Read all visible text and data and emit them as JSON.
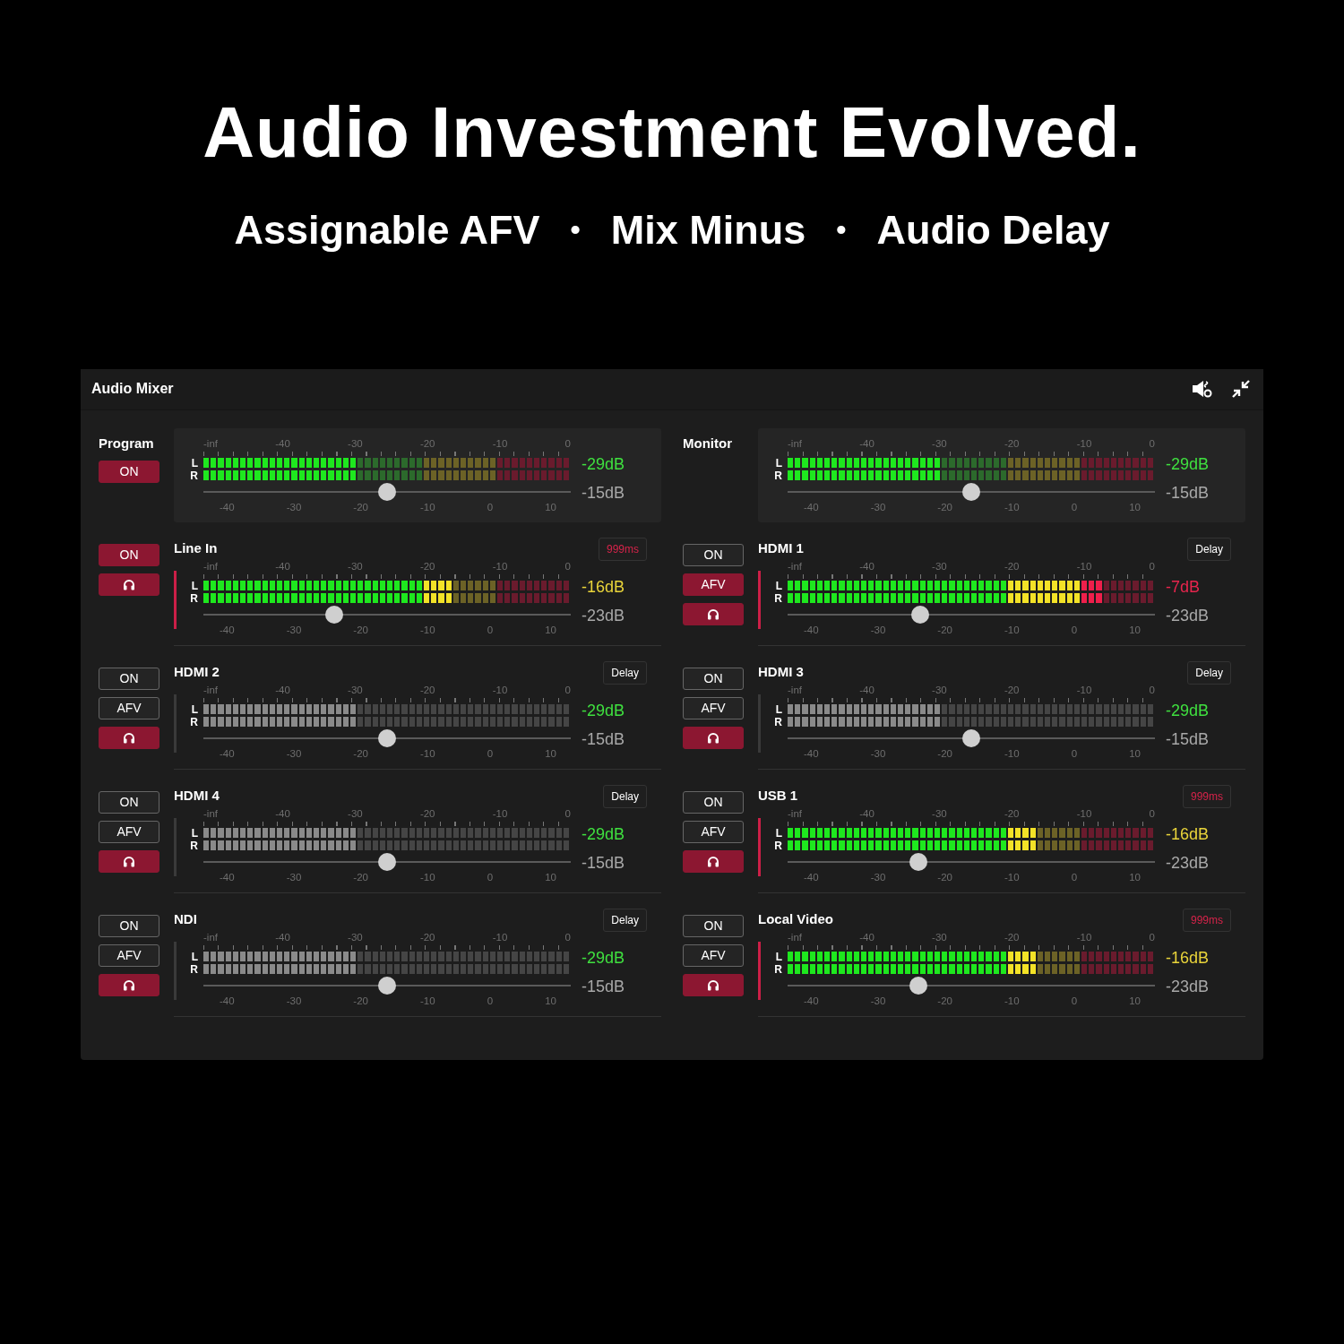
{
  "heading": "Audio Investment Evolved.",
  "subtitle": [
    {
      "kind": "feature",
      "text": "Assignable AFV"
    },
    {
      "kind": "separator",
      "text": "•"
    },
    {
      "kind": "feature",
      "text": "Mix Minus"
    },
    {
      "kind": "separator",
      "text": "•"
    },
    {
      "kind": "feature",
      "text": "Audio Delay"
    }
  ],
  "mixer": {
    "title": "Audio Mixer",
    "channels": [
      {
        "kind": "master",
        "name": "Program",
        "buttons": [
          {
            "kind": "on",
            "label": "ON",
            "selected": true
          }
        ],
        "signal": true,
        "meter_scale": [
          "-inf",
          "-40",
          "-30",
          "-20",
          "-10",
          "0"
        ],
        "channel_labels": [
          "L",
          "R"
        ],
        "meter": {
          "level": 0.42
        },
        "fader_scale": [
          "-40",
          "-30",
          "-20",
          "-10",
          "0",
          "10"
        ],
        "fader": {
          "level": 0.5
        },
        "peak": "-29dB",
        "gain": "-15dB"
      },
      {
        "kind": "master",
        "name": "Monitor",
        "signal": true,
        "meter_scale": [
          "-inf",
          "-40",
          "-30",
          "-20",
          "-10",
          "0"
        ],
        "channel_labels": [
          "L",
          "R"
        ],
        "meter": {
          "level": 0.42
        },
        "fader_scale": [
          "-40",
          "-30",
          "-20",
          "-10",
          "0",
          "10"
        ],
        "fader": {
          "level": 0.5
        },
        "peak": "-29dB",
        "gain": "-15dB"
      },
      {
        "kind": "input",
        "name": "Line In",
        "buttons": [
          {
            "kind": "on",
            "label": "ON",
            "selected": true
          },
          {
            "kind": "headphones",
            "selected": true
          }
        ],
        "delay": {
          "text": "999ms",
          "active": true
        },
        "signal": true,
        "meter_scale": [
          "-inf",
          "-40",
          "-30",
          "-20",
          "-10",
          "0"
        ],
        "channel_labels": [
          "L",
          "R"
        ],
        "meter": {
          "level": 0.68
        },
        "fader_scale": [
          "-40",
          "-30",
          "-20",
          "-10",
          "0",
          "10"
        ],
        "fader": {
          "level": 0.355
        },
        "peak": "-16dB",
        "gain": "-23dB"
      },
      {
        "kind": "input",
        "name": "HDMI 1",
        "buttons": [
          {
            "kind": "on",
            "label": "ON",
            "selected": false
          },
          {
            "kind": "afv",
            "label": "AFV",
            "selected": true
          },
          {
            "kind": "headphones",
            "selected": true
          }
        ],
        "delay": {
          "text": "Delay",
          "active": false
        },
        "signal": true,
        "meter_scale": [
          "-inf",
          "-40",
          "-30",
          "-20",
          "-10",
          "0"
        ],
        "channel_labels": [
          "L",
          "R"
        ],
        "meter": {
          "level": 0.86
        },
        "fader_scale": [
          "-40",
          "-30",
          "-20",
          "-10",
          "0",
          "10"
        ],
        "fader": {
          "level": 0.36
        },
        "peak": "-7dB",
        "gain": "-23dB"
      },
      {
        "kind": "input",
        "name": "HDMI 2",
        "buttons": [
          {
            "kind": "on",
            "label": "ON",
            "selected": false
          },
          {
            "kind": "afv",
            "label": "AFV",
            "selected": false
          },
          {
            "kind": "headphones",
            "selected": true
          }
        ],
        "delay": {
          "text": "Delay",
          "active": false
        },
        "signal": false,
        "meter_scale": [
          "-inf",
          "-40",
          "-30",
          "-20",
          "-10",
          "0"
        ],
        "channel_labels": [
          "L",
          "R"
        ],
        "meter": {
          "level": 0.42
        },
        "fader_scale": [
          "-40",
          "-30",
          "-20",
          "-10",
          "0",
          "10"
        ],
        "fader": {
          "level": 0.5
        },
        "peak": "-29dB",
        "gain": "-15dB"
      },
      {
        "kind": "input",
        "name": "HDMI 3",
        "buttons": [
          {
            "kind": "on",
            "label": "ON",
            "selected": false
          },
          {
            "kind": "afv",
            "label": "AFV",
            "selected": false
          },
          {
            "kind": "headphones",
            "selected": true
          }
        ],
        "delay": {
          "text": "Delay",
          "active": false
        },
        "signal": false,
        "meter_scale": [
          "-inf",
          "-40",
          "-30",
          "-20",
          "-10",
          "0"
        ],
        "channel_labels": [
          "L",
          "R"
        ],
        "meter": {
          "level": 0.42
        },
        "fader_scale": [
          "-40",
          "-30",
          "-20",
          "-10",
          "0",
          "10"
        ],
        "fader": {
          "level": 0.5
        },
        "peak": "-29dB",
        "gain": "-15dB"
      },
      {
        "kind": "input",
        "name": "HDMI 4",
        "buttons": [
          {
            "kind": "on",
            "label": "ON",
            "selected": false
          },
          {
            "kind": "afv",
            "label": "AFV",
            "selected": false
          },
          {
            "kind": "headphones",
            "selected": true
          }
        ],
        "delay": {
          "text": "Delay",
          "active": false
        },
        "signal": false,
        "meter_scale": [
          "-inf",
          "-40",
          "-30",
          "-20",
          "-10",
          "0"
        ],
        "channel_labels": [
          "L",
          "R"
        ],
        "meter": {
          "level": 0.42
        },
        "fader_scale": [
          "-40",
          "-30",
          "-20",
          "-10",
          "0",
          "10"
        ],
        "fader": {
          "level": 0.5
        },
        "peak": "-29dB",
        "gain": "-15dB"
      },
      {
        "kind": "input",
        "name": "USB 1",
        "buttons": [
          {
            "kind": "on",
            "label": "ON",
            "selected": false
          },
          {
            "kind": "afv",
            "label": "AFV",
            "selected": false
          },
          {
            "kind": "headphones",
            "selected": true
          }
        ],
        "delay": {
          "text": "999ms",
          "active": true
        },
        "signal": true,
        "meter_scale": [
          "-inf",
          "-40",
          "-30",
          "-20",
          "-10",
          "0"
        ],
        "channel_labels": [
          "L",
          "R"
        ],
        "meter": {
          "level": 0.68
        },
        "fader_scale": [
          "-40",
          "-30",
          "-20",
          "-10",
          "0",
          "10"
        ],
        "fader": {
          "level": 0.355
        },
        "peak": "-16dB",
        "gain": "-23dB"
      },
      {
        "kind": "input",
        "name": "NDI",
        "buttons": [
          {
            "kind": "on",
            "label": "ON",
            "selected": false
          },
          {
            "kind": "afv",
            "label": "AFV",
            "selected": false
          },
          {
            "kind": "headphones",
            "selected": true
          }
        ],
        "delay": {
          "text": "Delay",
          "active": false
        },
        "signal": false,
        "meter_scale": [
          "-inf",
          "-40",
          "-30",
          "-20",
          "-10",
          "0"
        ],
        "channel_labels": [
          "L",
          "R"
        ],
        "meter": {
          "level": 0.42
        },
        "fader_scale": [
          "-40",
          "-30",
          "-20",
          "-10",
          "0",
          "10"
        ],
        "fader": {
          "level": 0.5
        },
        "peak": "-29dB",
        "gain": "-15dB"
      },
      {
        "kind": "input",
        "name": "Local Video",
        "buttons": [
          {
            "kind": "on",
            "label": "ON",
            "selected": false
          },
          {
            "kind": "afv",
            "label": "AFV",
            "selected": false
          },
          {
            "kind": "headphones",
            "selected": true
          }
        ],
        "delay": {
          "text": "999ms",
          "active": true
        },
        "signal": true,
        "meter_scale": [
          "-inf",
          "-40",
          "-30",
          "-20",
          "-10",
          "0"
        ],
        "channel_labels": [
          "L",
          "R"
        ],
        "meter": {
          "level": 0.68
        },
        "fader_scale": [
          "-40",
          "-30",
          "-20",
          "-10",
          "0",
          "10"
        ],
        "fader": {
          "level": 0.355
        },
        "peak": "-16dB",
        "gain": "-23dB"
      }
    ]
  }
}
